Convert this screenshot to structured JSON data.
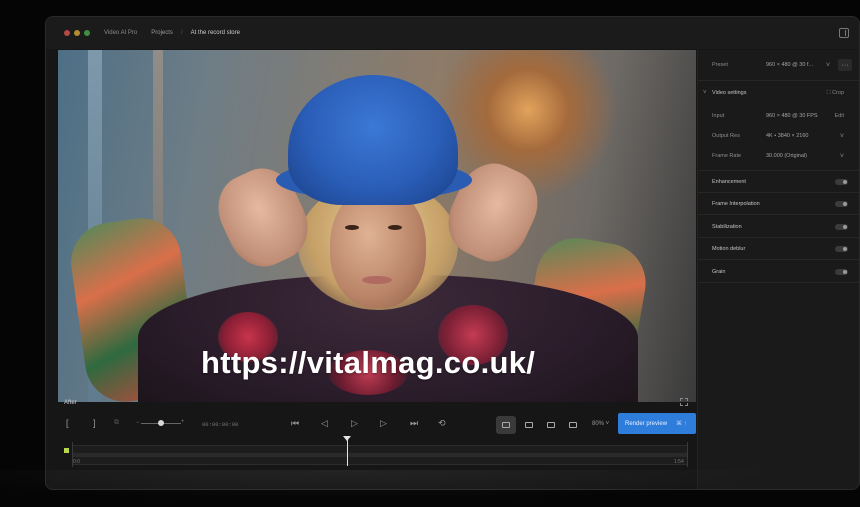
{
  "window": {
    "app_name": "Video AI Pro",
    "breadcrumb": [
      "Projects",
      "At the record store"
    ],
    "breadcrumb_sep": "/"
  },
  "viewer": {
    "label": "After",
    "watermark": "https://vitalmag.co.uk/"
  },
  "controls": {
    "in_bracket": "[",
    "out_bracket": "]",
    "timecode": "00:00:00:00",
    "zoom": "80%",
    "render_label": "Render preview",
    "render_kbd": "⌘ ↑"
  },
  "timeline": {
    "start_label": "0:0",
    "end_label": "1:54"
  },
  "sidebar": {
    "preset": {
      "label": "Preset",
      "value": "960 × 480 @ 30 f...",
      "more": "···"
    },
    "video_settings": {
      "title": "Video settings",
      "crop": "Crop"
    },
    "input": {
      "label": "Input",
      "value": "960 × 480 @ 30 FPS",
      "extra": "Edit"
    },
    "output_res": {
      "label": "Output Res",
      "value": "4K • 3840 × 2160"
    },
    "frame_rate": {
      "label": "Frame Rate",
      "value": "30.000 (Original)"
    },
    "toggles": [
      {
        "label": "Enhancement"
      },
      {
        "label": "Frame Interpolation"
      },
      {
        "label": "Stabilization"
      },
      {
        "label": "Motion deblur"
      },
      {
        "label": "Grain"
      }
    ]
  },
  "colors": {
    "accent": "#2f7ddb",
    "timeline_marker": "#b7d84b",
    "window_dots": [
      "#ff5f57",
      "#febc2e",
      "#28c840"
    ]
  }
}
